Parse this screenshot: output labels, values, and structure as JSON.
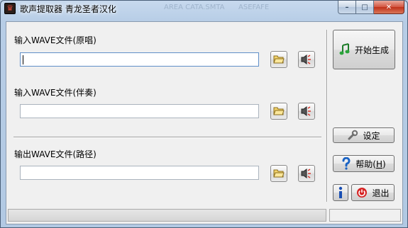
{
  "window": {
    "title": "歌声提取器 青龙圣者汉化",
    "ghost_text_1": "AREA CATA.SMTA",
    "ghost_text_2": "ASEFAFE",
    "minimize_glyph": "–",
    "maximize_glyph": "□",
    "close_glyph": "✕"
  },
  "inputs": {
    "original": {
      "label": "输入WAVE文件(原唱)",
      "value": ""
    },
    "accompaniment": {
      "label": "输入WAVE文件(伴奏)",
      "value": ""
    },
    "output": {
      "label": "输出WAVE文件(路径)",
      "value": ""
    }
  },
  "buttons": {
    "start": "开始生成",
    "settings": "设定",
    "help_prefix": "帮助(",
    "help_hotkey": "H",
    "help_suffix": ")",
    "exit": "退出"
  },
  "icons": {
    "browse": "folder-open-icon",
    "play": "speaker-icon",
    "start": "music-note-icon",
    "settings": "wrench-icon",
    "help": "question-mark-icon",
    "info": "info-icon",
    "exit": "power-icon"
  },
  "status": {
    "left": "",
    "right": ""
  }
}
